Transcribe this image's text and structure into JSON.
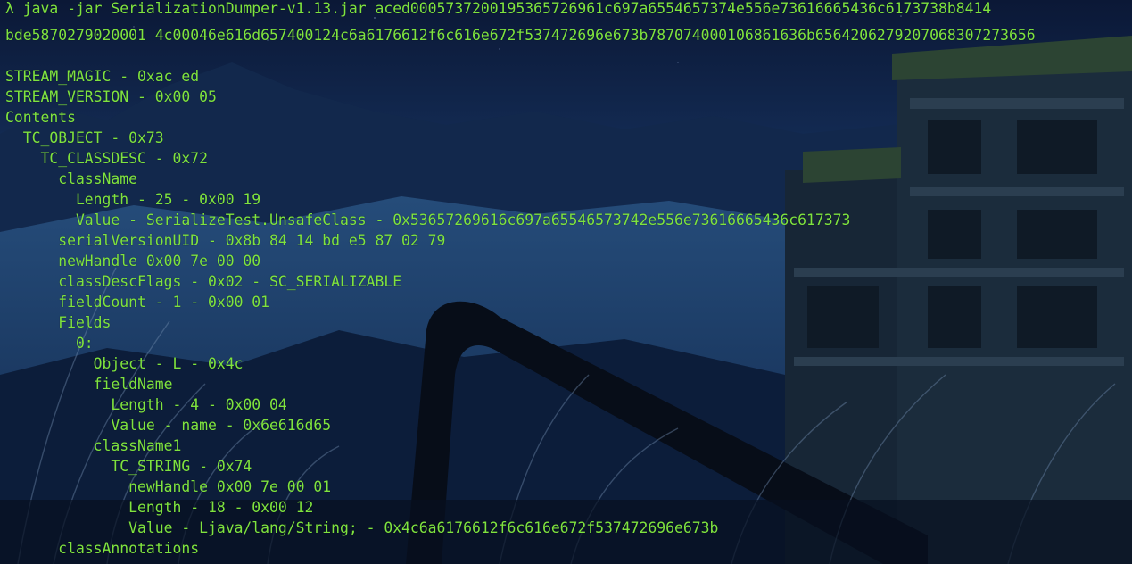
{
  "theme": {
    "text_color": "#7fe33f",
    "background": "#0a1630"
  },
  "terminal": {
    "lines": [
      "λ java -jar SerializationDumper-v1.13.jar aced0005737200195365726961c697a6554657374e556e73616665436c6173738b8414",
      "bde5870279020001 4c00046e616d657400124c6a6176612f6c616e672f537472696e673b787074000106861636b6564206279207068307273656",
      "",
      "STREAM_MAGIC - 0xac ed",
      "STREAM_VERSION - 0x00 05",
      "Contents",
      "  TC_OBJECT - 0x73",
      "    TC_CLASSDESC - 0x72",
      "      className",
      "        Length - 25 - 0x00 19",
      "        Value - SerializeTest.UnsafeClass - 0x53657269616c697a65546573742e556e73616665436c617373",
      "      serialVersionUID - 0x8b 84 14 bd e5 87 02 79",
      "      newHandle 0x00 7e 00 00",
      "      classDescFlags - 0x02 - SC_SERIALIZABLE",
      "      fieldCount - 1 - 0x00 01",
      "      Fields",
      "        0:",
      "          Object - L - 0x4c",
      "          fieldName",
      "            Length - 4 - 0x00 04",
      "            Value - name - 0x6e616d65",
      "          className1",
      "            TC_STRING - 0x74",
      "              newHandle 0x00 7e 00 01",
      "              Length - 18 - 0x00 12",
      "              Value - Ljava/lang/String; - 0x4c6a6176612f6c616e672f537472696e673b",
      "      classAnnotations"
    ]
  }
}
